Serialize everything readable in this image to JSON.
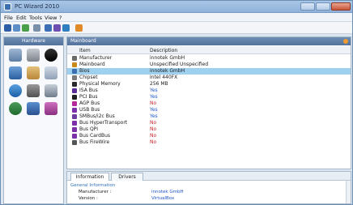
{
  "window": {
    "title": "PC Wizard 2010"
  },
  "menu": [
    "File",
    "Edit",
    "Tools",
    "View",
    "?"
  ],
  "toolbar": {
    "icons": [
      "save-icon",
      "copy-icon",
      "refresh-icon",
      "print-icon",
      "config-icon",
      "chart-icon",
      "info-icon",
      "help-icon"
    ]
  },
  "hardware_panel": {
    "title": "Hardware",
    "icons": [
      "mainboard-icon",
      "processor-icon",
      "video-icon",
      "drives-icon",
      "sound-icon",
      "ports-icon",
      "network-icon",
      "devices-icon",
      "printer-icon",
      "power-icon",
      "voltage-icon",
      "tools-icon"
    ]
  },
  "main_panel": {
    "title": "Mainboard",
    "columns": {
      "item": "Item",
      "description": "Description"
    },
    "rows": [
      {
        "label": "Manufacturer",
        "value": "innotek GmbH",
        "status": "plain",
        "icon_color": "#6b6b6b"
      },
      {
        "label": "Mainboard",
        "value": "Unspecified Unspecified",
        "status": "plain",
        "icon_color": "#c98a1a"
      },
      {
        "label": "Bios",
        "value": "innotek GmbH",
        "status": "plain",
        "icon_color": "#3a6fb0"
      },
      {
        "label": "Chipset",
        "value": "Intel 440FX",
        "status": "plain",
        "icon_color": "#7a7a7a"
      },
      {
        "label": "Physical Memory",
        "value": "256 MB",
        "status": "plain",
        "icon_color": "#2a2a2a"
      },
      {
        "label": "ISA Bus",
        "value": "Yes",
        "status": "yes",
        "icon_color": "#5b2d91"
      },
      {
        "label": "PCI Bus",
        "value": "Yes",
        "status": "yes",
        "icon_color": "#1e1e1e"
      },
      {
        "label": "AGP Bus",
        "value": "No",
        "status": "no",
        "icon_color": "#b62a9a"
      },
      {
        "label": "USB Bus",
        "value": "Yes",
        "status": "yes",
        "icon_color": "#7b2fa8"
      },
      {
        "label": "SMBus/i2c Bus",
        "value": "Yes",
        "status": "yes",
        "icon_color": "#6a3fa0"
      },
      {
        "label": "Bus HyperTransport",
        "value": "No",
        "status": "no",
        "icon_color": "#7b2fa8"
      },
      {
        "label": "Bus QPI",
        "value": "No",
        "status": "no",
        "icon_color": "#7b2fa8"
      },
      {
        "label": "Bus CardBus",
        "value": "No",
        "status": "no",
        "icon_color": "#7b2fa8"
      },
      {
        "label": "Bus FireWire",
        "value": "No",
        "status": "no",
        "icon_color": "#555555"
      }
    ]
  },
  "info_panel": {
    "tabs": [
      "Information",
      "Drivers"
    ],
    "section": "General Information",
    "lines": [
      {
        "label": "Manufacturer :",
        "value": "innotek GmbH"
      },
      {
        "label": "Version :",
        "value": "VirtualBox"
      }
    ]
  },
  "colors": {
    "selected_row": "#9fd0ee",
    "yes": "#1f56c9",
    "no": "#c8242c",
    "header": "#52729c"
  }
}
